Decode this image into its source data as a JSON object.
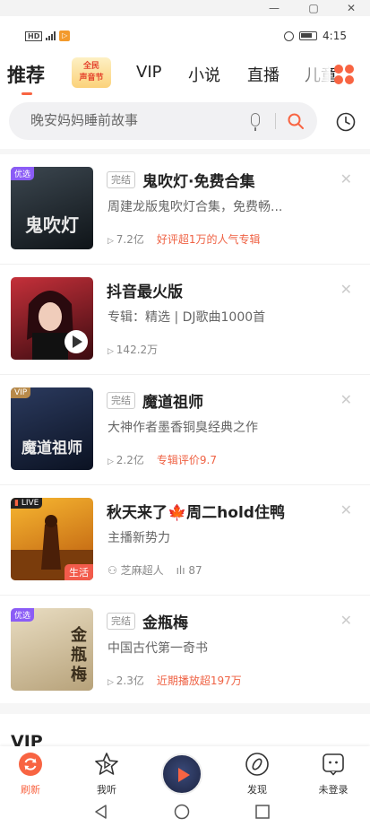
{
  "status_bar": {
    "time": "4:15",
    "hd_label": "HD",
    "app_badge": "▷"
  },
  "tabs": [
    {
      "label": "推荐",
      "active": true
    },
    {
      "label": "VIP",
      "active": false
    },
    {
      "label": "小说",
      "active": false
    },
    {
      "label": "直播",
      "active": false
    },
    {
      "label": "儿童",
      "active": false
    }
  ],
  "festival_badge": {
    "line1": "全民",
    "line2": "声音节"
  },
  "search": {
    "placeholder": "晚安妈妈睡前故事"
  },
  "feed": [
    {
      "cover_tag": "优选",
      "cover_tag_color": "#8b5cf6",
      "cover_text": "鬼吹灯",
      "cover_bg": "linear-gradient(160deg,#3c4750,#0f1418)",
      "complete_tag": "完结",
      "title": "鬼吹灯·免费合集",
      "subtitle": "周建龙版鬼吹灯合集，免费畅...",
      "plays": "7.2亿",
      "highlight": "好评超1万的人气专辑"
    },
    {
      "cover_tag": "",
      "cover_tag_color": "",
      "cover_text": "",
      "cover_bg": "linear-gradient(160deg,#c5303a,#3b0b10)",
      "complete_tag": "",
      "title": "抖音最火版",
      "subtitle": "专辑：精选 | DJ歌曲1000首",
      "plays": "142.2万",
      "highlight": ""
    },
    {
      "cover_tag": "VIP",
      "cover_tag_color": "#b88a4a",
      "cover_text": "魔道祖师",
      "cover_bg": "linear-gradient(160deg,#2b3a5e,#0b1222)",
      "complete_tag": "完结",
      "title": "魔道祖师",
      "subtitle": "大神作者墨香铜臭经典之作",
      "plays": "2.2亿",
      "highlight": "专辑评价9.7"
    },
    {
      "cover_tag": "LIVE",
      "cover_tag_color": "#222222",
      "cover_text": "",
      "corner_label": "生活",
      "cover_bg": "linear-gradient(160deg,#f7b731,#b8560c)",
      "complete_tag": "",
      "title": "秋天来了🍁周二hold住鸭",
      "subtitle": "主播新势力",
      "host": "芝麻超人",
      "listeners": "87"
    },
    {
      "cover_tag": "优选",
      "cover_tag_color": "#8b5cf6",
      "cover_text": "金瓶梅",
      "cover_bg": "linear-gradient(160deg,#e9ddc2,#b7a27a)",
      "complete_tag": "完结",
      "title": "金瓶梅",
      "subtitle": "中国古代第一奇书",
      "plays": "2.3亿",
      "highlight": "近期播放超197万"
    }
  ],
  "vip_section": {
    "title": "VIP"
  },
  "bottom_nav": [
    {
      "label": "刷新",
      "active": true
    },
    {
      "label": "我听",
      "active": false
    },
    {
      "label": "发现",
      "active": false
    },
    {
      "label": "未登录",
      "active": false
    }
  ],
  "colors": {
    "accent": "#f86442",
    "highlight": "#ef6244"
  }
}
